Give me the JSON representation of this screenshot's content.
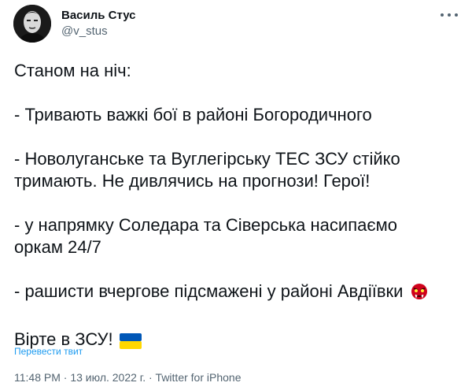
{
  "author": {
    "display_name": "Василь Стус",
    "handle": "@v_stus"
  },
  "tweet": {
    "line_1": "Станом на ніч:",
    "line_2": "- Тривають важкі бої в районі Богородичного",
    "line_3": "- Новолуганське та Вуглегірську ТЕС ЗСУ стійко\nтримають. Не дивлячись на прогнози! Герої!",
    "line_4": "- у напрямку Соледара та Сіверська насипаємо\nоркам 24/7",
    "line_5": "- рашисти вчергове підсмажені у районі Авдіївки",
    "line_6": "Вірте в ЗСУ!",
    "emoji_1": "ogre-mask-icon",
    "emoji_2": "ukraine-flag-icon"
  },
  "translate_label": "Перевести твит",
  "meta": {
    "time": "11:48 PM",
    "separator_1": " · ",
    "date": "13 июл. 2022 г.",
    "separator_2": " · ",
    "source": "Twitter for iPhone"
  },
  "colors": {
    "link": "#1d9bf0",
    "secondary_text": "#536471",
    "primary_text": "#0f1419",
    "flag_blue": "#0057b7",
    "flag_yellow": "#ffd700",
    "ogre_red": "#d0021b"
  }
}
